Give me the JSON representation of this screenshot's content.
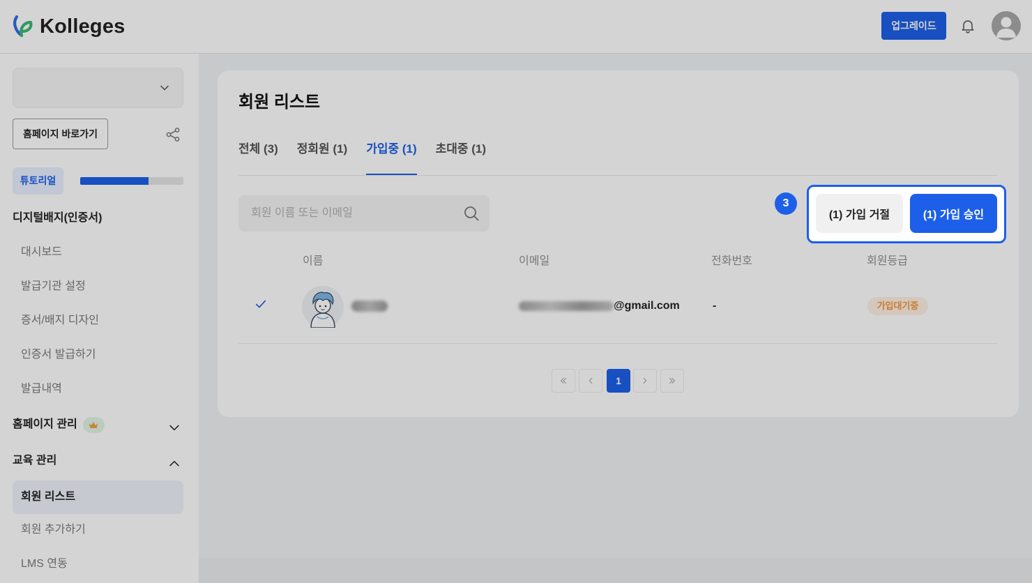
{
  "app": {
    "logo_text": "Kolleges"
  },
  "header": {
    "upgrade_label": "업그레이드",
    "icons": {
      "notifications": "bell-icon",
      "profile": "user-avatar-icon"
    }
  },
  "sidebar": {
    "workspace_select": {
      "value": "",
      "icon": "chevron-down-icon"
    },
    "homepage_button_label": "홈페이지 바로가기",
    "share_icon": "share-icon",
    "tutorial": {
      "label": "튜토리얼",
      "progress_percent": 66
    },
    "sections": [
      {
        "title": "디지털배지(인증서)",
        "items": [
          {
            "label": "대시보드"
          },
          {
            "label": "발급기관 설정"
          },
          {
            "label": "증서/배지 디자인"
          },
          {
            "label": "인증서 발급하기"
          },
          {
            "label": "발급내역"
          }
        ]
      },
      {
        "title": "홈페이지 관리",
        "premium_icon": "crown-icon",
        "expanded": false,
        "items": []
      },
      {
        "title": "교육 관리",
        "expanded": true,
        "items": [
          {
            "label": "회원 리스트",
            "active": true
          },
          {
            "label": "회원 추가하기",
            "active": false
          },
          {
            "label": "LMS 연동",
            "active": false
          }
        ]
      }
    ]
  },
  "main": {
    "title": "회원 리스트",
    "tabs": [
      {
        "label": "전체 (3)",
        "active": false
      },
      {
        "label": "정회원 (1)",
        "active": false
      },
      {
        "label": "가입중 (1)",
        "active": true
      },
      {
        "label": "초대중 (1)",
        "active": false
      }
    ],
    "search": {
      "placeholder": "회원 이름 또는 이메일",
      "value": "",
      "icon": "search-icon"
    },
    "actions": {
      "reject_label": "(1) 가입 거절",
      "approve_label": "(1) 가입 승인"
    },
    "guide_step": "3",
    "table": {
      "columns": [
        "이름",
        "이메일",
        "전화번호",
        "회원등급"
      ],
      "rows": [
        {
          "selected": true,
          "name_redacted": true,
          "email_prefix_redacted": true,
          "email_visible": "@gmail.com",
          "phone": "-",
          "grade": "가입대기중"
        }
      ]
    },
    "pagination": {
      "current_page": "1",
      "icons": [
        "first-page-icon",
        "prev-page-icon",
        "next-page-icon",
        "last-page-icon"
      ]
    }
  },
  "colors": {
    "brand": "#1d5fe8",
    "pending_text": "#f0963a",
    "pending_bg": "#fff0e2",
    "crown": "#f0a040"
  }
}
